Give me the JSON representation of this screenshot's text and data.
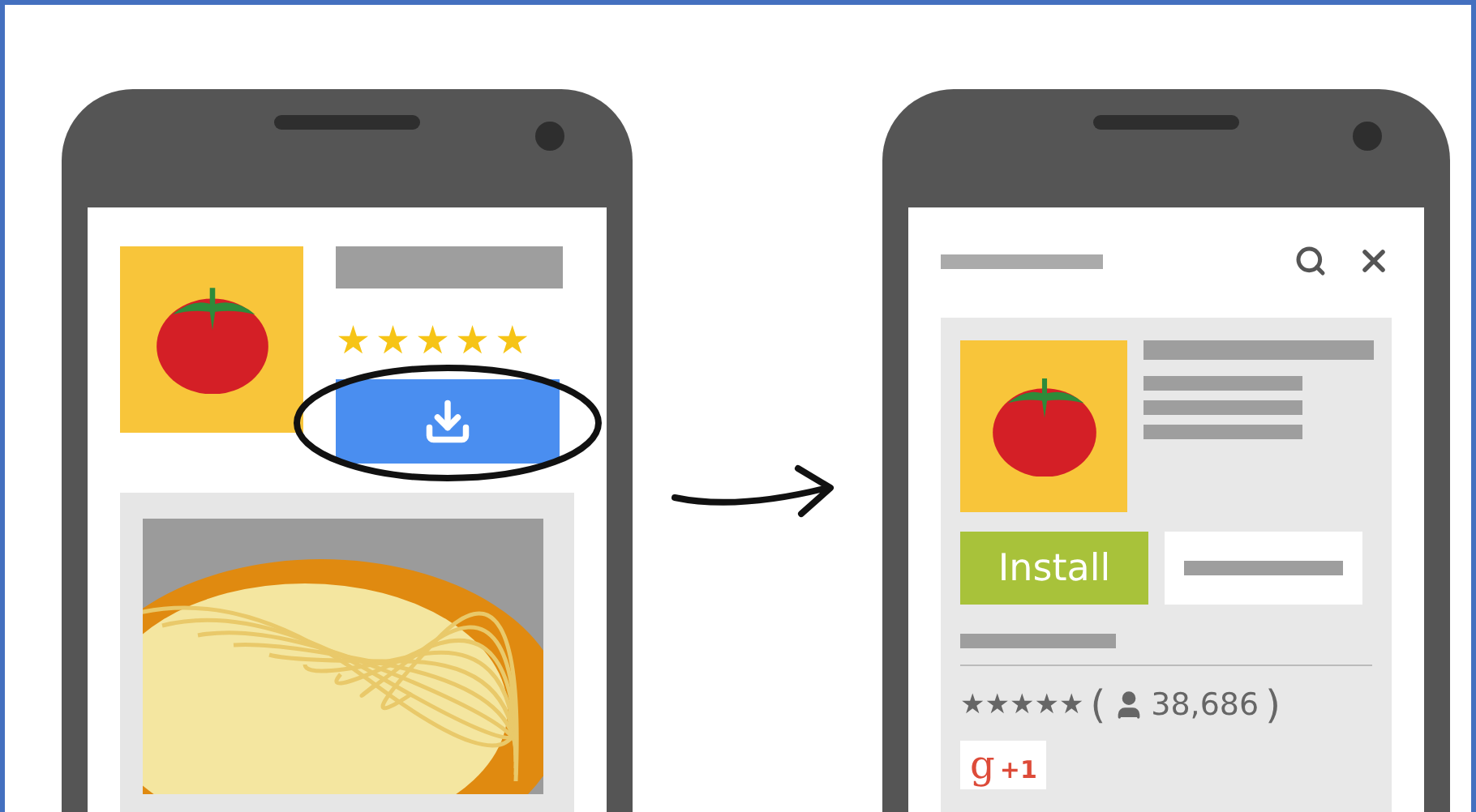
{
  "left_phone": {
    "app_rating": {
      "stars": 5
    },
    "download_button": {
      "circled": true
    }
  },
  "right_phone": {
    "ad_card": {
      "install_button": {
        "label": "Install"
      },
      "rating": {
        "stars": 5,
        "count_open": "(",
        "count": "38,686",
        "count_close": ")"
      },
      "plus_one": {
        "logo": "g",
        "label": "+1"
      }
    }
  }
}
